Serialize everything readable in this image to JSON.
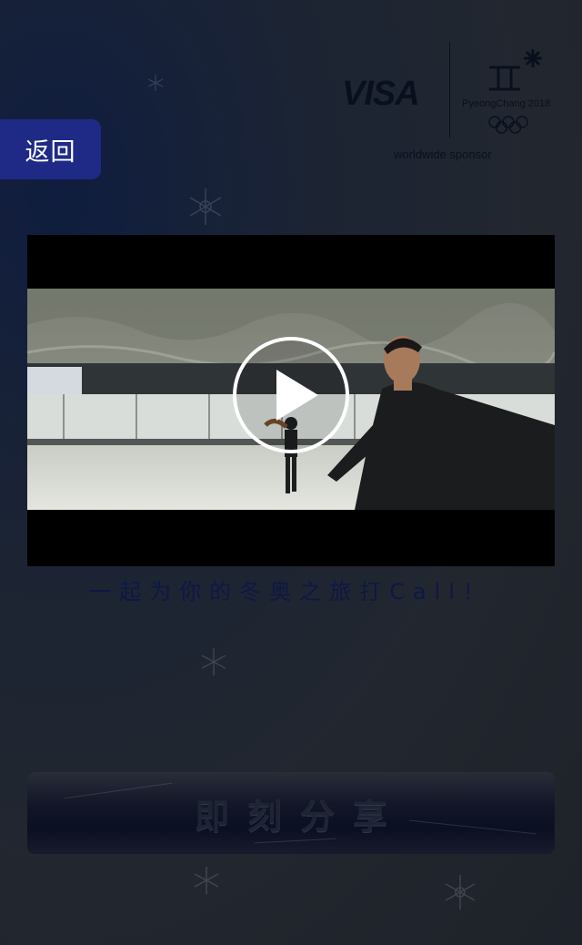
{
  "back_button": {
    "label": "返回"
  },
  "sponsor": {
    "brand": "VISA",
    "event_name": "PyeongChang 2018",
    "caption": "worldwide sponsor"
  },
  "video": {
    "play_icon": "play-icon"
  },
  "slogan": "一起为你的冬奥之旅打Call！",
  "share_button": {
    "label": "即刻分享"
  },
  "colors": {
    "back_button_bg": "#1e2a86",
    "slogan_text": "#0e1845",
    "page_bg": "#22272f"
  }
}
